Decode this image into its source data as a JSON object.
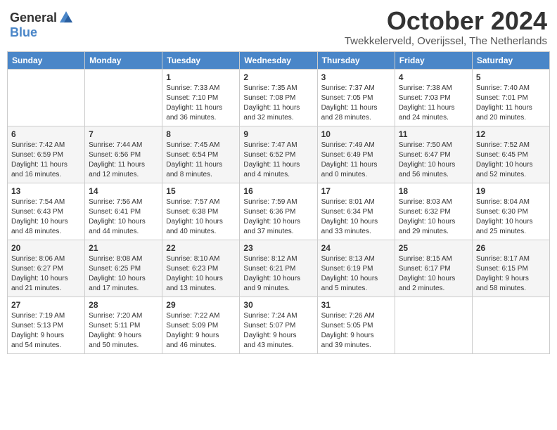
{
  "header": {
    "logo_general": "General",
    "logo_blue": "Blue",
    "month_title": "October 2024",
    "location": "Twekkelerveld, Overijssel, The Netherlands"
  },
  "days_of_week": [
    "Sunday",
    "Monday",
    "Tuesday",
    "Wednesday",
    "Thursday",
    "Friday",
    "Saturday"
  ],
  "weeks": [
    [
      {
        "day": "",
        "info": ""
      },
      {
        "day": "",
        "info": ""
      },
      {
        "day": "1",
        "info": "Sunrise: 7:33 AM\nSunset: 7:10 PM\nDaylight: 11 hours\nand 36 minutes."
      },
      {
        "day": "2",
        "info": "Sunrise: 7:35 AM\nSunset: 7:08 PM\nDaylight: 11 hours\nand 32 minutes."
      },
      {
        "day": "3",
        "info": "Sunrise: 7:37 AM\nSunset: 7:05 PM\nDaylight: 11 hours\nand 28 minutes."
      },
      {
        "day": "4",
        "info": "Sunrise: 7:38 AM\nSunset: 7:03 PM\nDaylight: 11 hours\nand 24 minutes."
      },
      {
        "day": "5",
        "info": "Sunrise: 7:40 AM\nSunset: 7:01 PM\nDaylight: 11 hours\nand 20 minutes."
      }
    ],
    [
      {
        "day": "6",
        "info": "Sunrise: 7:42 AM\nSunset: 6:59 PM\nDaylight: 11 hours\nand 16 minutes."
      },
      {
        "day": "7",
        "info": "Sunrise: 7:44 AM\nSunset: 6:56 PM\nDaylight: 11 hours\nand 12 minutes."
      },
      {
        "day": "8",
        "info": "Sunrise: 7:45 AM\nSunset: 6:54 PM\nDaylight: 11 hours\nand 8 minutes."
      },
      {
        "day": "9",
        "info": "Sunrise: 7:47 AM\nSunset: 6:52 PM\nDaylight: 11 hours\nand 4 minutes."
      },
      {
        "day": "10",
        "info": "Sunrise: 7:49 AM\nSunset: 6:49 PM\nDaylight: 11 hours\nand 0 minutes."
      },
      {
        "day": "11",
        "info": "Sunrise: 7:50 AM\nSunset: 6:47 PM\nDaylight: 10 hours\nand 56 minutes."
      },
      {
        "day": "12",
        "info": "Sunrise: 7:52 AM\nSunset: 6:45 PM\nDaylight: 10 hours\nand 52 minutes."
      }
    ],
    [
      {
        "day": "13",
        "info": "Sunrise: 7:54 AM\nSunset: 6:43 PM\nDaylight: 10 hours\nand 48 minutes."
      },
      {
        "day": "14",
        "info": "Sunrise: 7:56 AM\nSunset: 6:41 PM\nDaylight: 10 hours\nand 44 minutes."
      },
      {
        "day": "15",
        "info": "Sunrise: 7:57 AM\nSunset: 6:38 PM\nDaylight: 10 hours\nand 40 minutes."
      },
      {
        "day": "16",
        "info": "Sunrise: 7:59 AM\nSunset: 6:36 PM\nDaylight: 10 hours\nand 37 minutes."
      },
      {
        "day": "17",
        "info": "Sunrise: 8:01 AM\nSunset: 6:34 PM\nDaylight: 10 hours\nand 33 minutes."
      },
      {
        "day": "18",
        "info": "Sunrise: 8:03 AM\nSunset: 6:32 PM\nDaylight: 10 hours\nand 29 minutes."
      },
      {
        "day": "19",
        "info": "Sunrise: 8:04 AM\nSunset: 6:30 PM\nDaylight: 10 hours\nand 25 minutes."
      }
    ],
    [
      {
        "day": "20",
        "info": "Sunrise: 8:06 AM\nSunset: 6:27 PM\nDaylight: 10 hours\nand 21 minutes."
      },
      {
        "day": "21",
        "info": "Sunrise: 8:08 AM\nSunset: 6:25 PM\nDaylight: 10 hours\nand 17 minutes."
      },
      {
        "day": "22",
        "info": "Sunrise: 8:10 AM\nSunset: 6:23 PM\nDaylight: 10 hours\nand 13 minutes."
      },
      {
        "day": "23",
        "info": "Sunrise: 8:12 AM\nSunset: 6:21 PM\nDaylight: 10 hours\nand 9 minutes."
      },
      {
        "day": "24",
        "info": "Sunrise: 8:13 AM\nSunset: 6:19 PM\nDaylight: 10 hours\nand 5 minutes."
      },
      {
        "day": "25",
        "info": "Sunrise: 8:15 AM\nSunset: 6:17 PM\nDaylight: 10 hours\nand 2 minutes."
      },
      {
        "day": "26",
        "info": "Sunrise: 8:17 AM\nSunset: 6:15 PM\nDaylight: 9 hours\nand 58 minutes."
      }
    ],
    [
      {
        "day": "27",
        "info": "Sunrise: 7:19 AM\nSunset: 5:13 PM\nDaylight: 9 hours\nand 54 minutes."
      },
      {
        "day": "28",
        "info": "Sunrise: 7:20 AM\nSunset: 5:11 PM\nDaylight: 9 hours\nand 50 minutes."
      },
      {
        "day": "29",
        "info": "Sunrise: 7:22 AM\nSunset: 5:09 PM\nDaylight: 9 hours\nand 46 minutes."
      },
      {
        "day": "30",
        "info": "Sunrise: 7:24 AM\nSunset: 5:07 PM\nDaylight: 9 hours\nand 43 minutes."
      },
      {
        "day": "31",
        "info": "Sunrise: 7:26 AM\nSunset: 5:05 PM\nDaylight: 9 hours\nand 39 minutes."
      },
      {
        "day": "",
        "info": ""
      },
      {
        "day": "",
        "info": ""
      }
    ]
  ]
}
